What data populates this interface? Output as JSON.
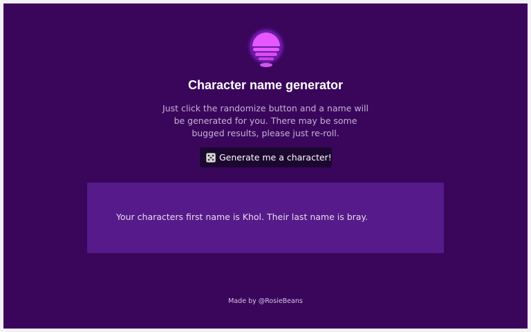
{
  "header": {
    "logo_icon": "sunset-over-water-icon",
    "title": "Character name generator",
    "description": "Just click the randomize button and a name will be generated for you. There may be some bugged results, please just re-roll."
  },
  "generate_button": {
    "icon": "dice-icon",
    "label": "Generate me a character!"
  },
  "result": {
    "text": "Your characters first name is Khol. Their last name is bray."
  },
  "footer": {
    "credit": "Made by @RosieBeans"
  },
  "colors": {
    "background": "#3a065c",
    "result_panel": "#561a8a",
    "button": "#1c0730",
    "logo_accent": "#e84dff"
  }
}
